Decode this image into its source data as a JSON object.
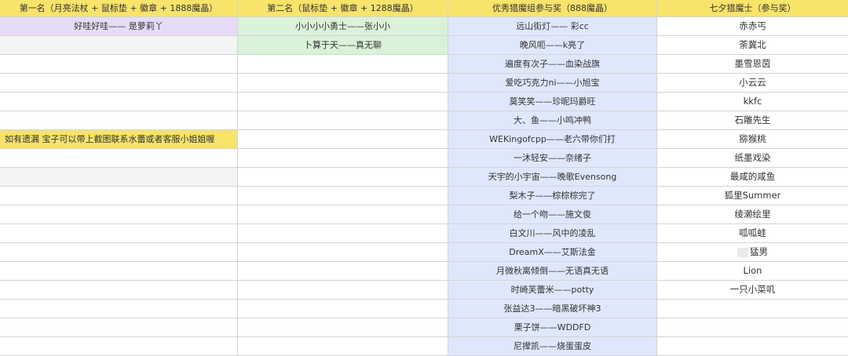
{
  "headers": [
    "第一名（月亮法杖 + 鼠标垫 + 徽章 + 1888魔晶）",
    "第二名（鼠标垫 + 徽章 + 1288魔晶）",
    "优秀猎魔组参与奖（888魔晶）",
    "七夕猎魔士（参与奖）"
  ],
  "col1": [
    "好哇好哇—— 是萝莉丫"
  ],
  "col2": [
    "小小小小勇士——张小小",
    "卜算于天——真无聊"
  ],
  "note": "如有遗漏 宝子可以带上截图联系水蕾或者客服小姐姐喔",
  "col3": [
    "远山街灯—— 彩cc",
    "晚风呃——k亮了",
    "遍度有次子——血染战旗",
    "爱吃巧克力ni——小旭宝",
    "莫笑笑——珍昵玛爵旺",
    "大、鱼——小鸣冲鸭",
    "WEKingofcpp——老六带你们打",
    "一沐轻安——奈绪子",
    "天宇的小宇宙——晚歌Evensong",
    "梨木子——棕棕棕完了",
    "给一个吻——施文俊",
    "白文川——风中的凌乱",
    "DreamX——艾斯法金",
    "月微秋离倾倒——无语真无语",
    "时崎芙蕾米——potty",
    "张益达3——暗黑破坏神3",
    "栗子饼——WDDFD",
    "尼撵凯——烧蛋蛋皮"
  ],
  "col4": [
    "赤赤丐",
    "荼冀北",
    "墨雪恩茵",
    "小云云",
    "kkfc",
    "石雕先生",
    "猕猴桃",
    "纸墨戏染",
    "最咸的咸鱼",
    "狐里Summer",
    "绫濑绘里",
    "呱呱蛙",
    "猛男",
    "Lion",
    "一只小菜叽"
  ]
}
